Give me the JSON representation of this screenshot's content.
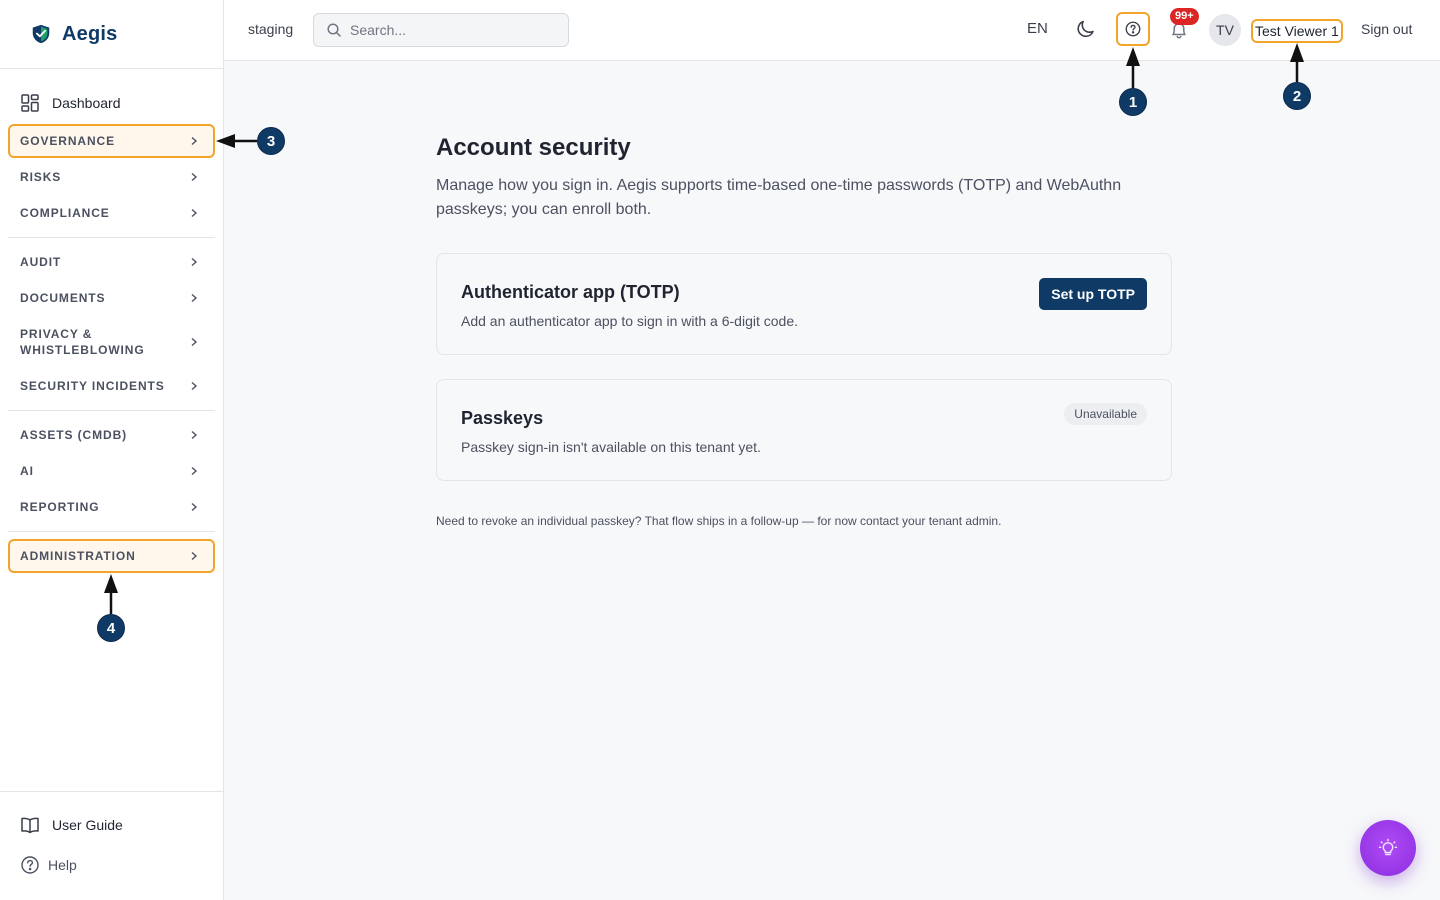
{
  "app": {
    "brand": "Aegis",
    "environment": "staging"
  },
  "colors": {
    "brand_navy": "#0f3a66",
    "highlight": "#f2a52d",
    "badge_red": "#dc2626",
    "fab_purple": "#a23ef0"
  },
  "header": {
    "search_placeholder": "Search...",
    "language": "EN",
    "notification_badge": "99+",
    "avatar_initials": "TV",
    "user_name": "Test Viewer 1",
    "sign_out": "Sign out",
    "icons": [
      "search-icon",
      "moon-icon",
      "help-circle-icon",
      "bell-icon"
    ]
  },
  "sidebar": {
    "dashboard": "Dashboard",
    "groups": [
      {
        "label": "GOVERNANCE"
      },
      {
        "label": "RISKS"
      },
      {
        "label": "COMPLIANCE"
      },
      {
        "label": "AUDIT"
      },
      {
        "label": "DOCUMENTS"
      },
      {
        "label": "PRIVACY & WHISTLEBLOWING"
      },
      {
        "label": "SECURITY INCIDENTS"
      },
      {
        "label": "ASSETS (CMDB)"
      },
      {
        "label": "AI"
      },
      {
        "label": "REPORTING"
      },
      {
        "label": "ADMINISTRATION"
      }
    ],
    "user_guide": "User Guide",
    "help": "Help"
  },
  "main": {
    "title": "Account security",
    "description": "Manage how you sign in. Aegis supports time-based one-time passwords (TOTP) and WebAuthn passkeys; you can enroll both.",
    "totp": {
      "title": "Authenticator app (TOTP)",
      "text": "Add an authenticator app to sign in with a 6-digit code.",
      "button": "Set up TOTP"
    },
    "passkeys": {
      "title": "Passkeys",
      "text": "Passkey sign-in isn't available on this tenant yet.",
      "status": "Unavailable"
    },
    "footnote": "Need to revoke an individual passkey? That flow ships in a follow-up — for now contact your tenant admin."
  },
  "annotations": [
    "1",
    "2",
    "3",
    "4"
  ]
}
